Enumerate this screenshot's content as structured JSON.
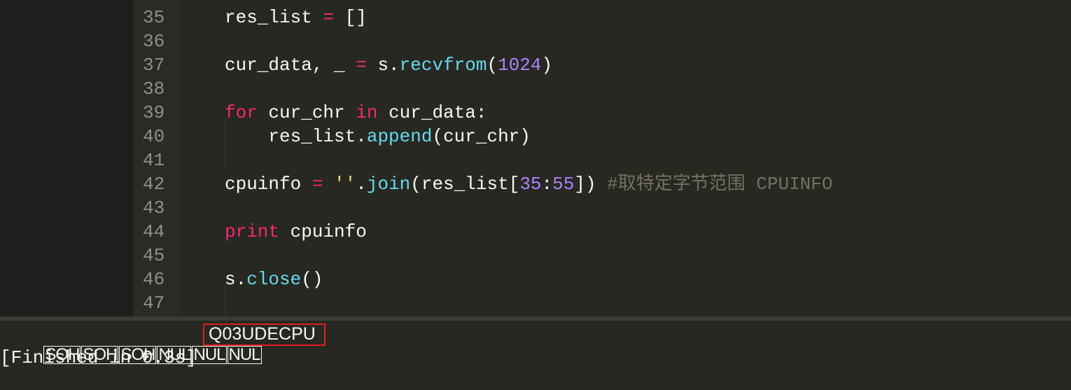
{
  "editor": {
    "lines": [
      {
        "n": "35",
        "tokens": [
          {
            "t": "res_list ",
            "c": ""
          },
          {
            "t": "=",
            "c": "kw"
          },
          {
            "t": " []",
            "c": ""
          }
        ]
      },
      {
        "n": "36",
        "tokens": []
      },
      {
        "n": "37",
        "tokens": [
          {
            "t": "cur_data, _ ",
            "c": ""
          },
          {
            "t": "=",
            "c": "kw"
          },
          {
            "t": " s.",
            "c": ""
          },
          {
            "t": "recvfrom",
            "c": "fn"
          },
          {
            "t": "(",
            "c": ""
          },
          {
            "t": "1024",
            "c": "num"
          },
          {
            "t": ")",
            "c": ""
          }
        ]
      },
      {
        "n": "38",
        "tokens": []
      },
      {
        "n": "39",
        "tokens": [
          {
            "t": "for",
            "c": "kw"
          },
          {
            "t": " cur_chr ",
            "c": ""
          },
          {
            "t": "in",
            "c": "kw"
          },
          {
            "t": " cur_data:",
            "c": ""
          }
        ]
      },
      {
        "n": "40",
        "tokens": [
          {
            "t": "    res_list.",
            "c": ""
          },
          {
            "t": "append",
            "c": "fn"
          },
          {
            "t": "(cur_chr)",
            "c": ""
          }
        ]
      },
      {
        "n": "41",
        "tokens": []
      },
      {
        "n": "42",
        "tokens": [
          {
            "t": "cpuinfo ",
            "c": ""
          },
          {
            "t": "=",
            "c": "kw"
          },
          {
            "t": " ",
            "c": ""
          },
          {
            "t": "''",
            "c": "str"
          },
          {
            "t": ".",
            "c": ""
          },
          {
            "t": "join",
            "c": "fn"
          },
          {
            "t": "(res_list[",
            "c": ""
          },
          {
            "t": "35",
            "c": "num"
          },
          {
            "t": ":",
            "c": ""
          },
          {
            "t": "55",
            "c": "num"
          },
          {
            "t": "]) ",
            "c": ""
          },
          {
            "t": "#取特定字节范围 CPUINFO",
            "c": "cmt"
          }
        ]
      },
      {
        "n": "43",
        "tokens": []
      },
      {
        "n": "44",
        "tokens": [
          {
            "t": "print",
            "c": "kw"
          },
          {
            "t": " cpuinfo",
            "c": ""
          }
        ]
      },
      {
        "n": "45",
        "tokens": []
      },
      {
        "n": "46",
        "tokens": [
          {
            "t": "s.",
            "c": ""
          },
          {
            "t": "close",
            "c": "fn"
          },
          {
            "t": "()",
            "c": ""
          }
        ]
      },
      {
        "n": "47",
        "tokens": []
      }
    ]
  },
  "output": {
    "control_chars": [
      "SOH",
      "SOH",
      "SOH",
      "NUL",
      "NUL",
      "NUL"
    ],
    "cpu_result": "Q03UDECPU",
    "finished": "[Finished in 0.3s]"
  },
  "colors": {
    "background": "#272822",
    "keyword": "#f92672",
    "function": "#66d9ef",
    "number": "#ae81ff",
    "string": "#e6db74",
    "comment": "#75715e",
    "highlight_border": "#e01f1f"
  }
}
